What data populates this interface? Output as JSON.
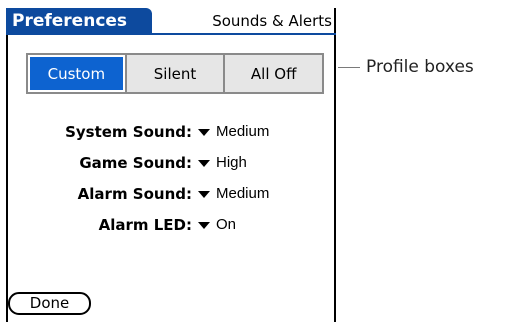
{
  "title_bar": {
    "menu_title": "Preferences",
    "app_name": "Sounds & Alerts"
  },
  "profiles": {
    "items": [
      {
        "label": "Custom",
        "selected": true
      },
      {
        "label": "Silent",
        "selected": false
      },
      {
        "label": "All Off",
        "selected": false
      }
    ]
  },
  "settings": {
    "system_sound": {
      "label": "System Sound:",
      "value": "Medium"
    },
    "game_sound": {
      "label": "Game Sound:",
      "value": "High"
    },
    "alarm_sound": {
      "label": "Alarm Sound:",
      "value": "Medium"
    },
    "alarm_led": {
      "label": "Alarm LED:",
      "value": "On"
    }
  },
  "buttons": {
    "done_label": "Done"
  },
  "callout": {
    "text": "Profile boxes"
  },
  "colors": {
    "title_blue": "#0d4a9e",
    "selected_blue": "#0d63d0",
    "control_border": "#8a8a8a",
    "control_bg": "#e6e6e6"
  },
  "icons": {
    "popup_trigger": "triangle-down-icon"
  }
}
